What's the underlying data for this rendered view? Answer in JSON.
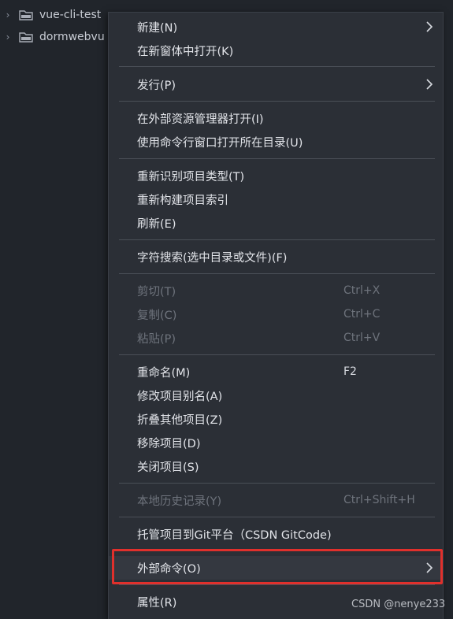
{
  "explorer": {
    "items": [
      {
        "label": "vue-cli-test"
      },
      {
        "label": "dormwebvu"
      }
    ]
  },
  "menu": {
    "items": [
      {
        "label": "新建(N)",
        "shortcut": "",
        "submenu": true,
        "disabled": false
      },
      {
        "label": "在新窗体中打开(K)",
        "shortcut": "",
        "submenu": false,
        "disabled": false
      },
      {
        "label": "发行(P)",
        "shortcut": "",
        "submenu": true,
        "disabled": false
      },
      {
        "label": "在外部资源管理器打开(I)",
        "shortcut": "",
        "submenu": false,
        "disabled": false
      },
      {
        "label": "使用命令行窗口打开所在目录(U)",
        "shortcut": "",
        "submenu": false,
        "disabled": false
      },
      {
        "label": "重新识别项目类型(T)",
        "shortcut": "",
        "submenu": false,
        "disabled": false
      },
      {
        "label": "重新构建项目索引",
        "shortcut": "",
        "submenu": false,
        "disabled": false
      },
      {
        "label": "刷新(E)",
        "shortcut": "",
        "submenu": false,
        "disabled": false
      },
      {
        "label": "字符搜索(选中目录或文件)(F)",
        "shortcut": "",
        "submenu": false,
        "disabled": false
      },
      {
        "label": "剪切(T)",
        "shortcut": "Ctrl+X",
        "submenu": false,
        "disabled": true
      },
      {
        "label": "复制(C)",
        "shortcut": "Ctrl+C",
        "submenu": false,
        "disabled": true
      },
      {
        "label": "粘贴(P)",
        "shortcut": "Ctrl+V",
        "submenu": false,
        "disabled": true
      },
      {
        "label": "重命名(M)",
        "shortcut": "F2",
        "submenu": false,
        "disabled": false
      },
      {
        "label": "修改项目别名(A)",
        "shortcut": "",
        "submenu": false,
        "disabled": false
      },
      {
        "label": "折叠其他项目(Z)",
        "shortcut": "",
        "submenu": false,
        "disabled": false
      },
      {
        "label": "移除项目(D)",
        "shortcut": "",
        "submenu": false,
        "disabled": false
      },
      {
        "label": "关闭项目(S)",
        "shortcut": "",
        "submenu": false,
        "disabled": false
      },
      {
        "label": "本地历史记录(Y)",
        "shortcut": "Ctrl+Shift+H",
        "submenu": false,
        "disabled": true
      },
      {
        "label": "托管项目到Git平台（CSDN GitCode)",
        "shortcut": "",
        "submenu": false,
        "disabled": false
      },
      {
        "label": "外部命令(O)",
        "shortcut": "",
        "submenu": true,
        "disabled": false
      },
      {
        "label": "属性(R)",
        "shortcut": "",
        "submenu": false,
        "disabled": false
      }
    ]
  },
  "watermark": "CSDN @nenye233",
  "colors": {
    "background": "#21252b",
    "menu_background": "#2b2f36",
    "highlight_box": "#e0302c"
  }
}
